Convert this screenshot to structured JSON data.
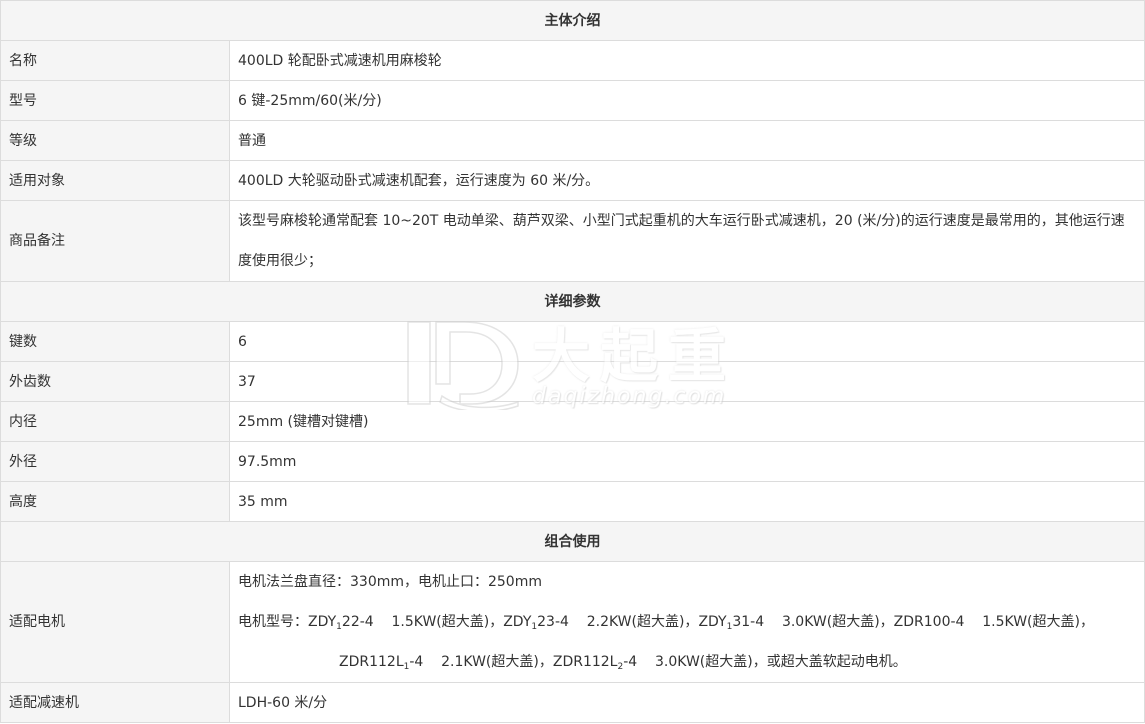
{
  "sections": {
    "intro": "主体介绍",
    "params": "详细参数",
    "combo": "组合使用"
  },
  "rows": {
    "name": {
      "label": "名称",
      "value": "400LD 轮配卧式减速机用麻梭轮"
    },
    "model": {
      "label": "型号",
      "value": "6 键-25mm/60(米/分)"
    },
    "grade": {
      "label": "等级",
      "value": "普通"
    },
    "applicable": {
      "label": "适用对象",
      "value": "400LD 大轮驱动卧式减速机配套，运行速度为 60 米/分。"
    },
    "remark": {
      "label": "商品备注",
      "value": "该型号麻梭轮通常配套 10~20T 电动单梁、葫芦双梁、小型门式起重机的大车运行卧式减速机，20 (米/分)的运行速度是最常用的，其他运行速度使用很少；"
    },
    "keys": {
      "label": "键数",
      "value": "6"
    },
    "teeth": {
      "label": "外齿数",
      "value": "37"
    },
    "inner": {
      "label": "内径",
      "value": "25mm (键槽对键槽)"
    },
    "outer": {
      "label": "外径",
      "value": "97.5mm"
    },
    "height": {
      "label": "高度",
      "value": "35 mm"
    },
    "motor": {
      "label": "适配电机",
      "line1": "电机法兰盘直径：330mm，电机止口：250mm",
      "line2_prefix": "电机型号：",
      "m1a": "ZDY",
      "m1sub": "1",
      "m1b": "22-4",
      "m1spec": "1.5KW(超大盖)，",
      "m2a": "ZDY",
      "m2sub": "1",
      "m2b": "23-4",
      "m2spec": "2.2KW(超大盖)，",
      "m3a": "ZDY",
      "m3sub": "1",
      "m3b": "31-4",
      "m3spec": "3.0KW(超大盖)，",
      "m4": "ZDR100-4",
      "m4spec": "1.5KW(超大盖)，",
      "m5a": "ZDR112L",
      "m5sub": "1",
      "m5b": "-4",
      "m5spec": "2.1KW(超大盖)，",
      "m6a": "ZDR112L",
      "m6sub": "2",
      "m6b": "-4",
      "m6spec": "3.0KW(超大盖)，或超大盖软起动电机。"
    },
    "reducer": {
      "label": "适配减速机",
      "value": "LDH-60 米/分"
    }
  },
  "watermark": {
    "cn": "大起重",
    "en": "daqizhong.com"
  }
}
